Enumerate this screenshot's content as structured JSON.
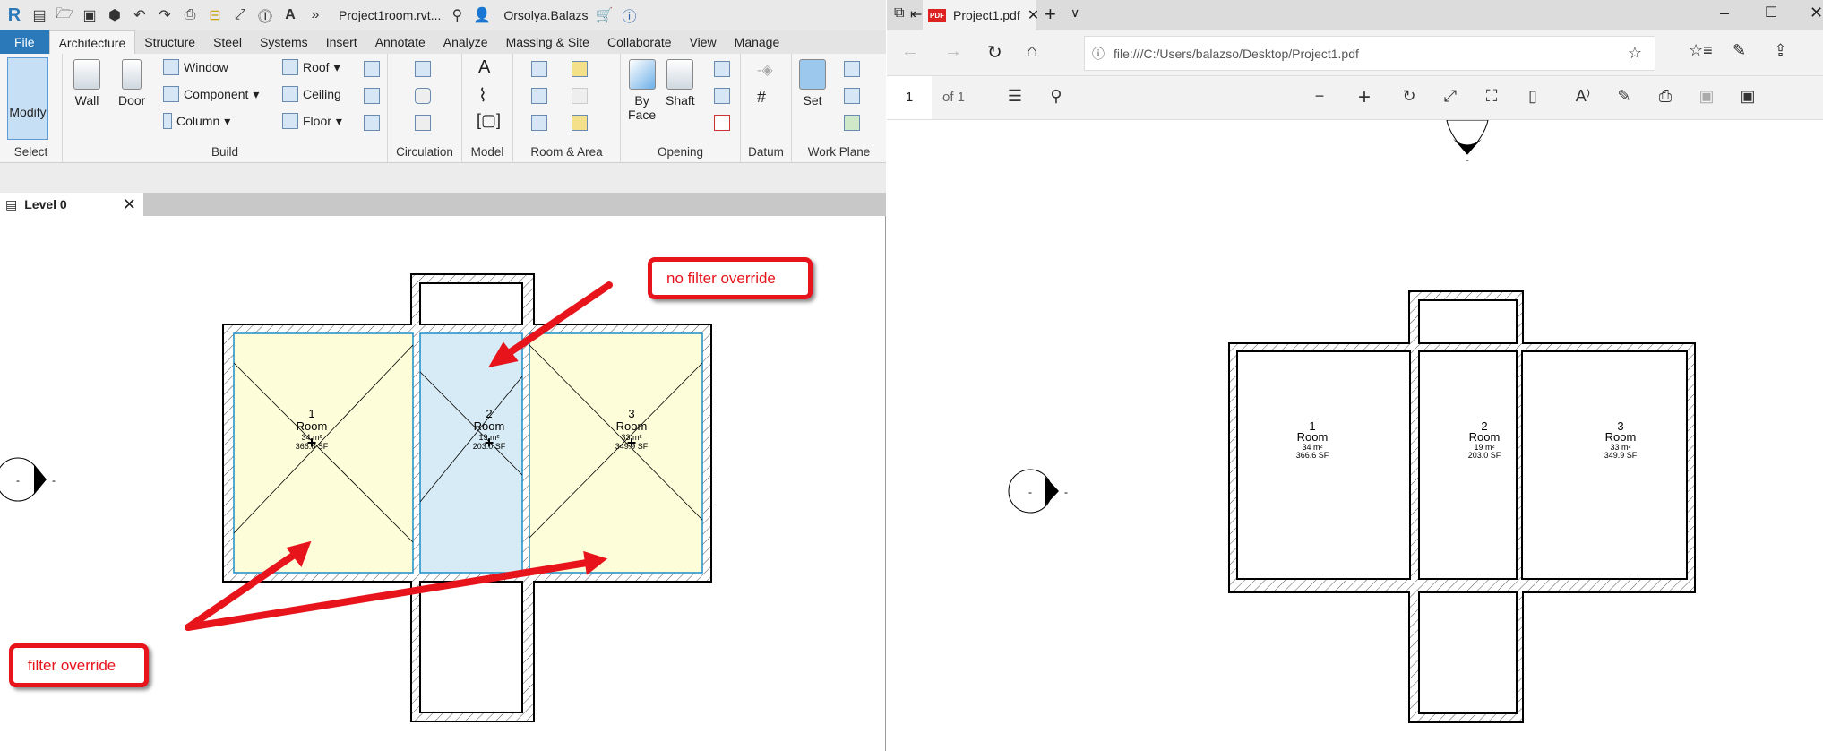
{
  "revit": {
    "qat": {
      "title": "Project1room.rvt...",
      "user": "Orsolya.Balazs"
    },
    "tabs": [
      "File",
      "Architecture",
      "Structure",
      "Steel",
      "Systems",
      "Insert",
      "Annotate",
      "Analyze",
      "Massing & Site",
      "Collaborate",
      "View",
      "Manage"
    ],
    "panels": {
      "select": "Select",
      "build": "Build",
      "circulation": "Circulation",
      "model": "Model",
      "room_area": "Room & Area",
      "opening": "Opening",
      "datum": "Datum",
      "work_plane": "Work Plane"
    },
    "buttons": {
      "modify": "Modify",
      "wall": "Wall",
      "door": "Door",
      "window": "Window",
      "component": "Component",
      "column": "Column",
      "roof": "Roof",
      "ceiling": "Ceiling",
      "floor": "Floor",
      "by_face_1": "By",
      "by_face_2": "Face",
      "shaft": "Shaft",
      "set": "Set"
    },
    "view_tab": "Level 0",
    "rooms": [
      {
        "number": "1",
        "name": "Room",
        "area_m2": "34 m²",
        "area_sf": "366.6 SF"
      },
      {
        "number": "2",
        "name": "Room",
        "area_m2": "19 m²",
        "area_sf": "203.0 SF"
      },
      {
        "number": "3",
        "name": "Room",
        "area_m2": "33 m²",
        "area_sf": "349.9 SF"
      }
    ],
    "section_mark": "-",
    "callouts": {
      "no_filter": "no filter override",
      "filter": "filter override"
    },
    "colors": {
      "filter_fill": "#fdfdd9",
      "no_filter_fill": "#d6ebf5",
      "callout": "#e8141c"
    }
  },
  "edge": {
    "tab_title": "Project1.pdf",
    "address": "file:///C:/Users/balazso/Desktop/Project1.pdf",
    "page": "1",
    "page_of": "of 1",
    "rooms": [
      {
        "number": "1",
        "name": "Room",
        "area_m2": "34 m²",
        "area_sf": "366.6 SF"
      },
      {
        "number": "2",
        "name": "Room",
        "area_m2": "19 m²",
        "area_sf": "203.0 SF"
      },
      {
        "number": "3",
        "name": "Room",
        "area_m2": "33 m²",
        "area_sf": "349.9 SF"
      }
    ],
    "section_mark": "-"
  }
}
